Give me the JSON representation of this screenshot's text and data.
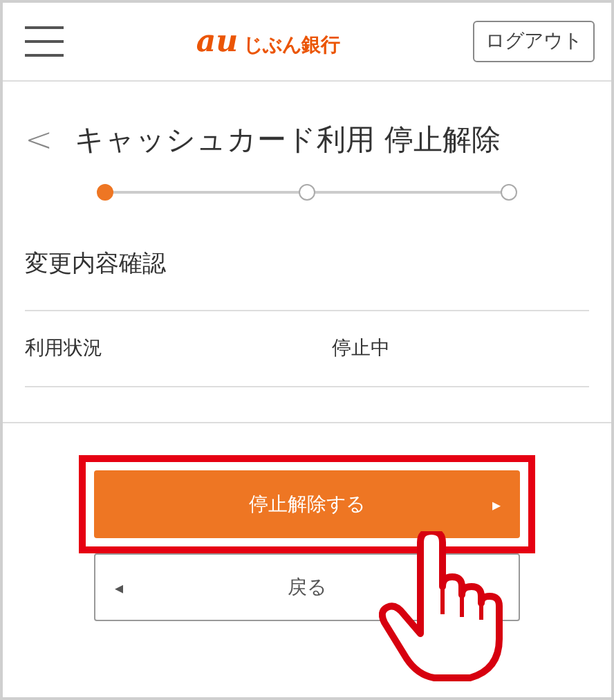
{
  "header": {
    "logo_mark": "au",
    "logo_text": "じぶん銀行",
    "logout_button": "ログアウト"
  },
  "title": {
    "back": "<",
    "text": "キャッシュカード利用 停止解除"
  },
  "steps": [
    {
      "selected": true
    },
    {
      "selected": false
    },
    {
      "selected": false
    }
  ],
  "section_title": "変更内容確認",
  "rows": [
    {
      "label": "利用状況",
      "value": "停止中"
    }
  ],
  "primary_button": {
    "label": "停止解除する",
    "arrow": "▸",
    "highlighted": true
  },
  "back_button": {
    "label": "戻る",
    "arrow": "◂"
  }
}
